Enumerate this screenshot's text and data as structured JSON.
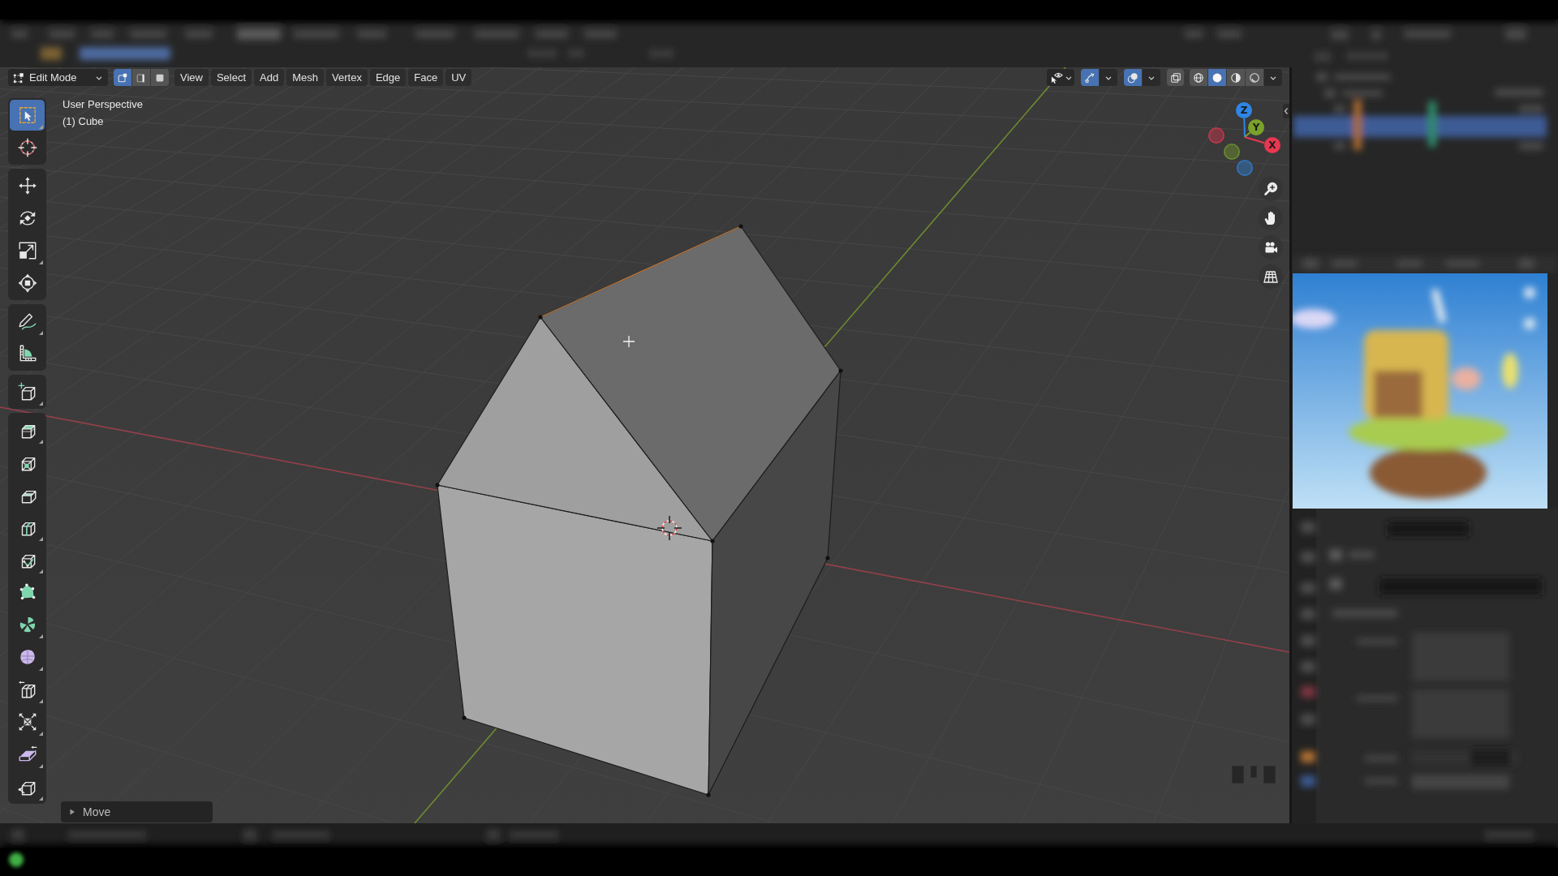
{
  "viewport_header": {
    "mode": "Edit Mode",
    "select_modes": [
      {
        "kind": "vertex",
        "selected": true
      },
      {
        "kind": "edge",
        "selected": false
      },
      {
        "kind": "face",
        "selected": false
      }
    ],
    "menus": [
      {
        "label": "View"
      },
      {
        "label": "Select"
      },
      {
        "label": "Add"
      },
      {
        "label": "Mesh"
      },
      {
        "label": "Vertex"
      },
      {
        "label": "Edge"
      },
      {
        "label": "Face"
      },
      {
        "label": "UV"
      }
    ],
    "gizmos": {
      "on": true
    },
    "overlays": {
      "on": true
    },
    "xray": {
      "on": false
    },
    "shading": [
      {
        "kind": "wireframe",
        "selected": false
      },
      {
        "kind": "solid",
        "selected": true
      },
      {
        "kind": "material",
        "selected": false
      },
      {
        "kind": "rendered",
        "selected": false
      }
    ]
  },
  "view_info": {
    "view": "User Perspective",
    "object": "(1) Cube"
  },
  "toolbar": {
    "groups": [
      {
        "tools": [
          {
            "kind": "select_box",
            "selected": true,
            "variants": true
          },
          {
            "kind": "cursor",
            "selected": false,
            "variants": false
          }
        ]
      },
      {
        "tools": [
          {
            "kind": "move",
            "selected": false,
            "variants": false
          },
          {
            "kind": "rotate",
            "selected": false,
            "variants": false
          },
          {
            "kind": "scale",
            "selected": false,
            "variants": true
          },
          {
            "kind": "transform",
            "selected": false,
            "variants": false
          }
        ]
      },
      {
        "tools": [
          {
            "kind": "annotate",
            "selected": false,
            "variants": true
          },
          {
            "kind": "measure",
            "selected": false,
            "variants": false
          }
        ]
      },
      {
        "tools": [
          {
            "kind": "add_cube",
            "selected": false,
            "variants": true
          }
        ]
      },
      {
        "tools": [
          {
            "kind": "extrude",
            "selected": false,
            "variants": true
          },
          {
            "kind": "inset",
            "selected": false,
            "variants": false
          },
          {
            "kind": "bevel",
            "selected": false,
            "variants": false
          },
          {
            "kind": "loop_cut",
            "selected": false,
            "variants": true
          },
          {
            "kind": "knife",
            "selected": false,
            "variants": true
          },
          {
            "kind": "poly_build",
            "selected": false,
            "variants": false
          },
          {
            "kind": "spin",
            "selected": false,
            "variants": true
          },
          {
            "kind": "smooth",
            "selected": false,
            "variants": true
          },
          {
            "kind": "edge_slide",
            "selected": false,
            "variants": true
          },
          {
            "kind": "shrink_fatten",
            "selected": false,
            "variants": true
          },
          {
            "kind": "shear",
            "selected": false,
            "variants": true
          },
          {
            "kind": "rip_region",
            "selected": false,
            "variants": true
          }
        ]
      }
    ]
  },
  "navigation_gizmo": {
    "axes": [
      {
        "label": "Z",
        "color": "#2f86e6"
      },
      {
        "label": "Y",
        "color": "#7aa22a"
      },
      {
        "label": "X",
        "color": "#e8374f"
      }
    ]
  },
  "last_operator": {
    "label": "Move",
    "expanded": false
  }
}
